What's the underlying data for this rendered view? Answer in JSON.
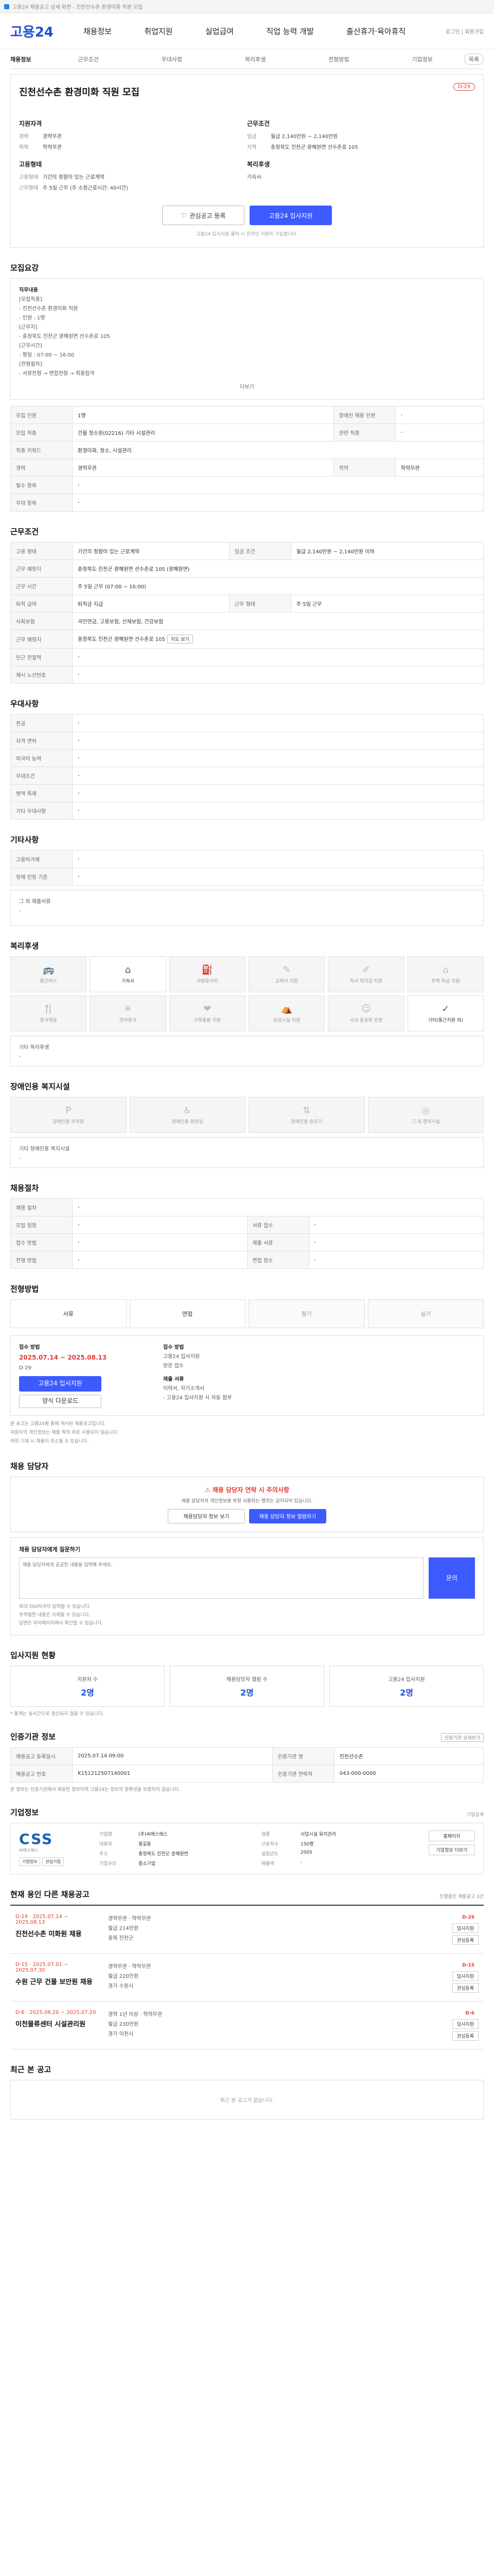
{
  "topbar": {
    "text": "고용24 채용공고 상세 화면 - 진천선수촌 환경미화 직원 모집"
  },
  "header": {
    "logo": "고용24",
    "nav": [
      "채용정보",
      "취업지원",
      "실업급여",
      "직업 능력 개발",
      "출산휴가·육아휴직"
    ],
    "right": "로그인 | 회원가입"
  },
  "subnav": {
    "crumb": "채용정보",
    "items": [
      "근무조건",
      "우대사항",
      "복리후생",
      "전형방법",
      "기업정보"
    ],
    "pill": "목록"
  },
  "post": {
    "title": "진천선수촌 환경미화 직원 모집",
    "dday": "D-29",
    "qual_h": "지원자격",
    "qual": [
      [
        "경력",
        "경력무관"
      ],
      [
        "학력",
        "학력무관"
      ]
    ],
    "emp_h": "고용형태",
    "emp": [
      [
        "고용형태",
        "기간의 정함이 있는 근로계약"
      ],
      [
        "근무형태",
        "주 5일 근무 (주 소정근로시간: 40시간)"
      ]
    ],
    "cond_h": "근무조건",
    "cond": [
      [
        "임금",
        "월급 2,140만원 ~ 2,140만원"
      ],
      [
        "지역",
        "충청북도 진천군 광혜원면 선수촌로 105"
      ]
    ],
    "benefit_h": "복리후생",
    "benefit": [
      [
        "",
        "기숙사"
      ]
    ],
    "btn_scrap": "관심공고 등록",
    "btn_apply": "고용24 입사지원",
    "note": "고용24 입사지원 클릭 시 온라인 지원이 가능합니다."
  },
  "duty": {
    "title": "모집요강",
    "label": "직무내용",
    "lines": [
      "[모집직종]",
      "- 진천선수촌 환경미화 직원",
      "- 인원 : 1명",
      "[근무지]",
      "- 충청북도 진천군 광혜원면 선수촌로 105",
      "[근무시간]",
      "- 평일 : 07:00 ~ 16:00",
      "[전형절차]",
      "- 서류전형 → 면접전형 → 최종합격"
    ],
    "more": "더보기"
  },
  "recruit_table": [
    [
      "모집 인원",
      "1명",
      "장애인 채용 인원",
      "-"
    ],
    [
      "모집 직종",
      "건물 청소원(02216) 기타 시설관리",
      "관련 직종",
      "-"
    ],
    [
      "직종 키워드",
      "환경미화, 청소, 시설관리",
      "",
      ""
    ],
    [
      "경력",
      "경력무관",
      "학력",
      "학력무관"
    ],
    [
      "필수 항목",
      "-",
      "",
      ""
    ],
    [
      "우대 항목",
      "-",
      "",
      ""
    ]
  ],
  "work": {
    "title": "근무조건",
    "rows": [
      [
        "고용 형태",
        "기간의 정함이 있는 근로계약",
        "임금 조건",
        "월급 2,140만원 ~ 2,140만원 이하"
      ],
      [
        "근무 예정지",
        "충청북도 진천군 광혜원면 선수촌로 105 (광혜원면)",
        "",
        ""
      ],
      [
        "근무 시간",
        "주 5일 근무 (07:00 ~ 16:00)",
        "",
        ""
      ],
      [
        "퇴직 급여",
        "퇴직금 지급",
        "근무 형태",
        "주 5일 근무"
      ],
      [
        "사회보험",
        "국민연금, 고용보험, 산재보험, 건강보험",
        "",
        ""
      ],
      [
        "근무 예정지",
        "충청북도 진천군 광혜원면 선수촌로 105",
        "",
        ""
      ],
      [
        "인근 전철역",
        "-",
        "",
        ""
      ],
      [
        "재시 노선번호",
        "-",
        "",
        ""
      ]
    ],
    "map_label": "지도 보기"
  },
  "pref": {
    "title": "우대사항",
    "rows": [
      [
        "전공",
        "-"
      ],
      [
        "자격 면허",
        "-"
      ],
      [
        "외국어 능력",
        "-"
      ],
      [
        "우대조건",
        "-"
      ],
      [
        "병역 특례",
        "-"
      ],
      [
        "기타 우대사항",
        "-"
      ]
    ]
  },
  "etc": {
    "title": "기타사항",
    "rows": [
      [
        "고용허가제",
        "-"
      ],
      [
        "장애 인정 기준",
        "-"
      ]
    ],
    "note_label": "그 외 제출서류",
    "note_val": "-"
  },
  "welfare": {
    "title": "복리후생",
    "items": [
      "통근버스",
      "기숙사",
      "차량유지비",
      "교육비 지원",
      "자녀 학자금 지원",
      "주택 자금 지원",
      "중식제공",
      "연차휴가",
      "가족돌봄 지원",
      "휴양시설 지원",
      "사내 동호회 운영",
      "기타(통근지원 외)"
    ],
    "on": [
      1,
      11
    ],
    "other_label": "기타 복리후생",
    "other_val": "-"
  },
  "disabled": {
    "title": "장애인용 복지시설",
    "items": [
      "장애인용 주차장",
      "장애인용 화장실",
      "장애인용 승강기",
      "그 외 편의시설"
    ],
    "other_label": "기타 장애인용 복지시설",
    "other_val": "-"
  },
  "process": {
    "title": "채용절차",
    "rows": [
      [
        "채용 절차",
        "-",
        "",
        ""
      ],
      [
        "모집 일정",
        "-",
        "서류 접수",
        "-"
      ],
      [
        "접수 방법",
        "-",
        "제출 서류",
        "-"
      ],
      [
        "전형 방법",
        "-",
        "면접 장소",
        "-"
      ]
    ]
  },
  "steps": {
    "title": "전형방법",
    "items": [
      "서류",
      "면접",
      "필기",
      "실기"
    ],
    "on": [
      0,
      1
    ]
  },
  "apply": {
    "title": "접수 방법",
    "dates": "2025.07.14 ~ 2025.08.13",
    "d_label": "D-29",
    "way_label": "접수 방법",
    "way": [
      "고용24 입사지원",
      "방문 접수"
    ],
    "docs_label": "제출 서류",
    "docs": [
      "이력서, 자기소개서",
      "- 고용24 입사지원 시 자동 첨부"
    ],
    "method_btn": "고용24 입사지원",
    "sample_btn": "양식 다운로드",
    "notes": [
      "본 공고는 고용24를 통해 게시된 채용공고입니다.",
      "지원자의 개인정보는 채용 목적 외로 사용되지 않습니다.",
      "허위 기재 시 채용이 취소될 수 있습니다."
    ]
  },
  "contact": {
    "title": "채용 담당자",
    "warn_red": "채용 담당자 연락 시 주의사항",
    "warn_body": "채용 담당자의 개인정보를 부정 사용하는 행위는 금지되어 있습니다.",
    "btn1": "채용담당자 정보 보기",
    "btn2": "채용 담당자 정보 열람하기",
    "ask_label": "채용 담당자에게 질문하기",
    "ask_placeholder": "채용 담당자에게 궁금한 내용을 입력해 주세요.",
    "ask_btn": "문의",
    "ask_notes": [
      "최대 500자까지 입력할 수 있습니다.",
      "부적절한 내용은 삭제될 수 있습니다.",
      "답변은 마이페이지에서 확인할 수 있습니다."
    ]
  },
  "stats": {
    "title": "입사지원 현황",
    "items": [
      [
        "지원자 수",
        "2명"
      ],
      [
        "채용담당자 열람 수",
        "2명"
      ],
      [
        "고용24 입사지원",
        "2명"
      ]
    ],
    "note": "* 통계는 실시간으로 갱신되지 않을 수 있습니다."
  },
  "info": {
    "title": "인증기관 정보",
    "right": "인증기관 상세보기",
    "rows": [
      [
        "채용공고 등록일시",
        "2025.07.14 09:00",
        "인증기관 명",
        "진천선수촌"
      ],
      [
        "채용공고 번호",
        "K151212507140001",
        "인증기관 연락처",
        "043-000-0000"
      ]
    ],
    "note": "본 정보는 인증기관에서 제공한 정보이며 고용24는 정보의 정확성을 보증하지 않습니다."
  },
  "company": {
    "title": "기업정보",
    "right": "기업상세",
    "logo": "CSS",
    "logo_sub": "씨에스에스",
    "mini": [
      "기업정보",
      "관심기업"
    ],
    "info": [
      [
        "기업명",
        "(주)씨에스에스",
        "업종",
        "사업시설 유지관리"
      ],
      [
        "대표자",
        "홍길동",
        "근로자수",
        "150명"
      ],
      [
        "주소",
        "충청북도 진천군 광혜원면",
        "설립년도",
        "2005"
      ],
      [
        "기업규모",
        "중소기업",
        "매출액",
        "-"
      ]
    ],
    "links": [
      "홈페이지",
      "기업정보 더보기"
    ]
  },
  "jobs": {
    "title": "현재 용인 다른 채용공고",
    "right": "진행중인 채용공고 3건",
    "items": [
      {
        "dates": "D-29 · 2025.07.14 ~ 2025.08.13",
        "title": "진천선수촌 미화원 채용",
        "info": [
          "경력무관 · 학력무관",
          "월급 214만원",
          "충북 진천군"
        ],
        "dday": "D-29",
        "b1": "입사지원",
        "b2": "관심등록"
      },
      {
        "dates": "D-15 · 2025.07.01 ~ 2025.07.30",
        "title": "수원 근무 건물 보안원 채용",
        "info": [
          "경력무관 · 학력무관",
          "월급 220만원",
          "경기 수원시"
        ],
        "dday": "D-15",
        "b1": "입사지원",
        "b2": "관심등록"
      },
      {
        "dates": "D-6 · 2025.06.20 ~ 2025.07.20",
        "title": "이천물류센터 시설관리원",
        "info": [
          "경력 1년 이상 · 학력무관",
          "월급 230만원",
          "경기 이천시"
        ],
        "dday": "D-6",
        "b1": "입사지원",
        "b2": "관심등록"
      }
    ]
  },
  "recent": {
    "title": "최근 본 공고",
    "empty": "최근 본 공고가 없습니다."
  }
}
